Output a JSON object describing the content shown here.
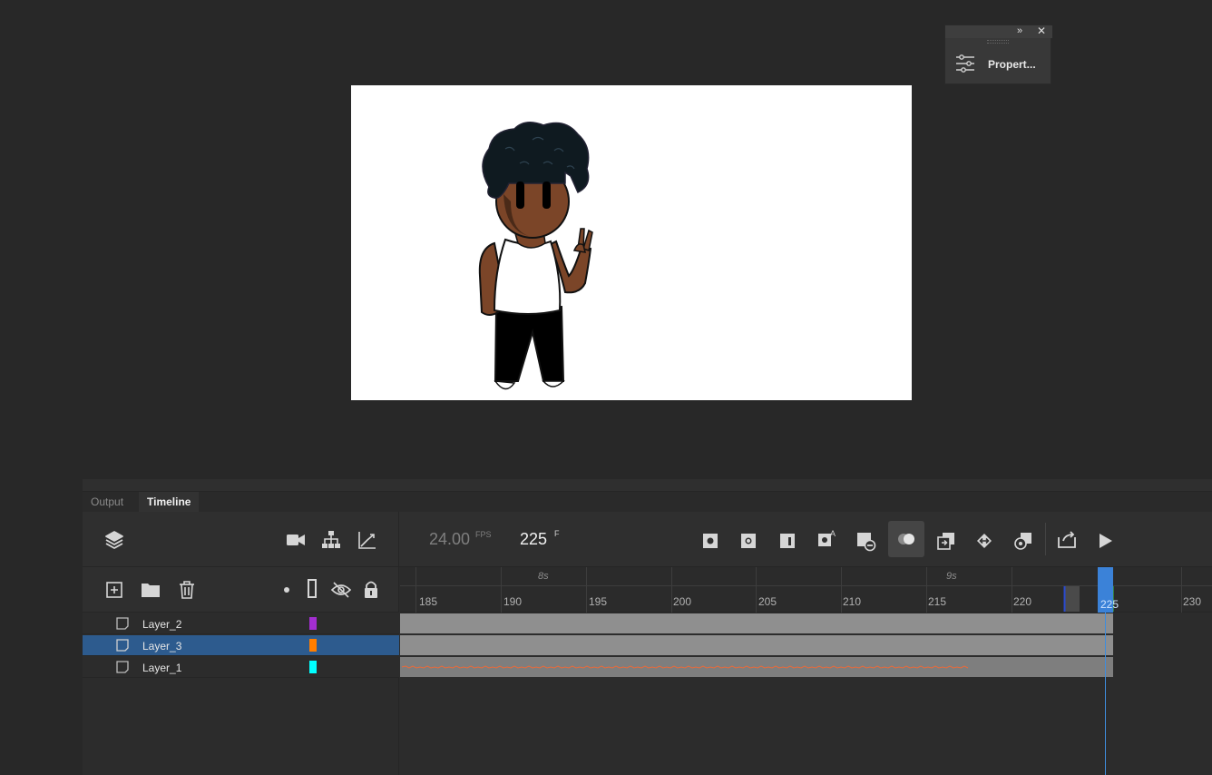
{
  "properties_panel": {
    "label": "Propert...",
    "expand_glyph": "»",
    "close_glyph": "✕",
    "icon": "sliders-icon"
  },
  "stage": {
    "background": "#ffffff",
    "artwork": "character-illustration"
  },
  "timeline_panel": {
    "tabs": [
      {
        "label": "Output",
        "active": false
      },
      {
        "label": "Timeline",
        "active": true
      }
    ],
    "toolbar_left_icons": [
      "layers-icon",
      "camera-icon",
      "parenting-icon",
      "graph-icon"
    ],
    "fps": {
      "value": "24.00",
      "unit": "FPS"
    },
    "frame": {
      "value": "225",
      "unit": "F"
    },
    "toolbar_right_icons": [
      "insert-keyframe-icon",
      "insert-blank-keyframe-icon",
      "insert-frame-icon",
      "auto-keyframe-icon",
      "remove-frame-icon",
      "onion-skin-icon",
      "paste-frames-icon",
      "swap-frames-icon",
      "paste-motion-icon",
      "loop-icon",
      "play-icon"
    ],
    "layer_tools_icons": [
      "new-layer-icon",
      "new-folder-icon",
      "delete-icon",
      "highlight-dot-icon",
      "outline-icon",
      "hide-icon",
      "lock-icon"
    ],
    "ruler": {
      "seconds": [
        "8s",
        "9s"
      ],
      "frame_labels": [
        "185",
        "190",
        "195",
        "200",
        "205",
        "210",
        "215",
        "220",
        "225",
        "230"
      ],
      "playhead_label": "225"
    },
    "layers": [
      {
        "name": "Layer_2",
        "color": "#a32ed1",
        "selected": false
      },
      {
        "name": "Layer_3",
        "color": "#ff7e00",
        "selected": true
      },
      {
        "name": "Layer_1",
        "color": "#00ffff",
        "selected": false
      }
    ],
    "colors": {
      "accent": "#3b82d8",
      "selection": "#2d5b8e",
      "audio_wave": "#e96a3a"
    }
  }
}
